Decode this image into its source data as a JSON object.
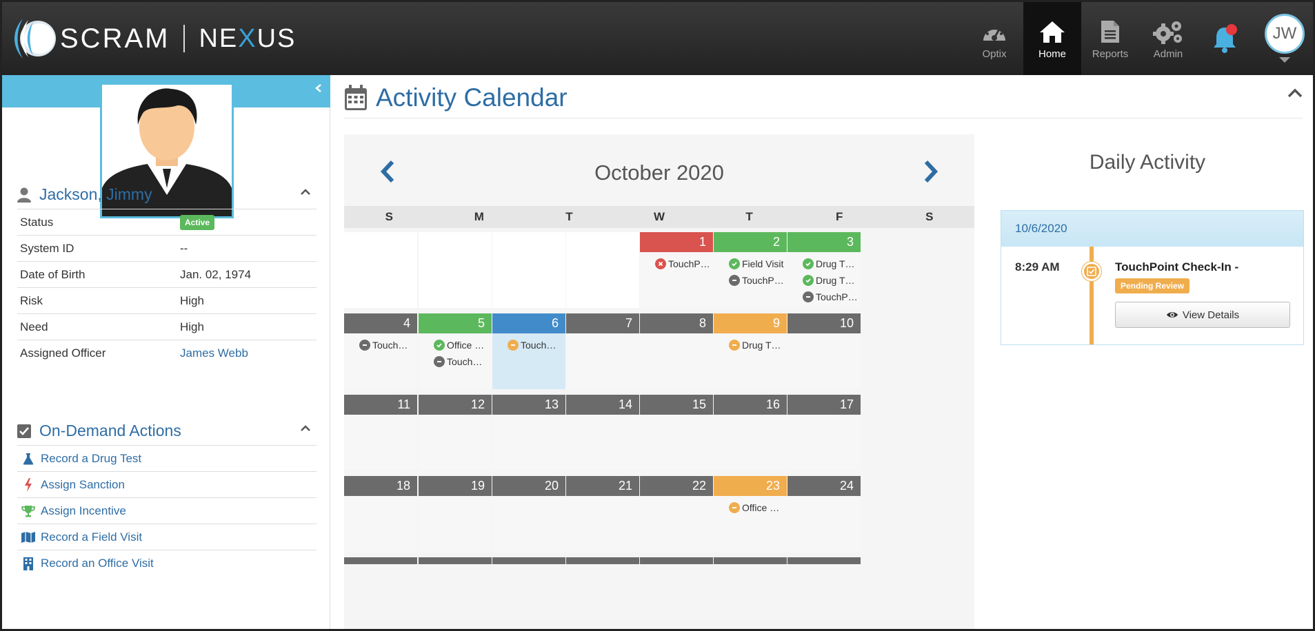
{
  "app": {
    "logo_text": "SCRAM",
    "logo_suffix_a": "NE",
    "logo_suffix_x": "X",
    "logo_suffix_b": "US"
  },
  "nav": {
    "items": [
      {
        "label": "Optix",
        "icon": "gauge-icon",
        "active": false
      },
      {
        "label": "Home",
        "icon": "home-icon",
        "active": true
      },
      {
        "label": "Reports",
        "icon": "document-icon",
        "active": false
      },
      {
        "label": "Admin",
        "icon": "gears-icon",
        "active": false
      }
    ],
    "user_initials": "JW",
    "notification_color": "#e8373d"
  },
  "profile": {
    "name": "Jackson, Jimmy",
    "rows": [
      {
        "label": "Status",
        "value": "Active",
        "type": "badge"
      },
      {
        "label": "System ID",
        "value": "--"
      },
      {
        "label": "Date of Birth",
        "value": "Jan. 02, 1974"
      },
      {
        "label": "Risk",
        "value": "High"
      },
      {
        "label": "Need",
        "value": "High"
      },
      {
        "label": "Assigned Officer",
        "value": "James Webb",
        "type": "link"
      }
    ]
  },
  "actions": {
    "title": "On-Demand Actions",
    "items": [
      {
        "label": "Record a Drug Test",
        "icon": "flask-icon",
        "color": "#2e6da4"
      },
      {
        "label": "Assign Sanction",
        "icon": "bolt-icon",
        "color": "#d9534f"
      },
      {
        "label": "Assign Incentive",
        "icon": "trophy-icon",
        "color": "#5cb85c"
      },
      {
        "label": "Record a Field Visit",
        "icon": "map-icon",
        "color": "#2e6da4"
      },
      {
        "label": "Record an Office Visit",
        "icon": "building-icon",
        "color": "#2e6da4"
      }
    ]
  },
  "calendar": {
    "title": "Activity Calendar",
    "month_label": "October 2020",
    "days_of_week": [
      "S",
      "M",
      "T",
      "W",
      "T",
      "F",
      "S"
    ],
    "weeks": [
      [
        {
          "day": null
        },
        {
          "day": null
        },
        {
          "day": null
        },
        {
          "day": null
        },
        {
          "day": "1",
          "header": "red",
          "events": [
            {
              "label": "TouchP…",
              "status": "fail"
            }
          ]
        },
        {
          "day": "2",
          "header": "green",
          "events": [
            {
              "label": "Field Visit",
              "status": "ok"
            },
            {
              "label": "TouchP…",
              "status": "neutral"
            }
          ]
        },
        {
          "day": "3",
          "header": "green",
          "events": [
            {
              "label": "Drug T…",
              "status": "ok"
            },
            {
              "label": "Drug T…",
              "status": "ok"
            },
            {
              "label": "TouchP…",
              "status": "neutral"
            }
          ]
        }
      ],
      [
        {
          "day": "4",
          "header": "gray",
          "events": [
            {
              "label": "Touch…",
              "status": "neutral"
            }
          ]
        },
        {
          "day": "5",
          "header": "green",
          "events": [
            {
              "label": "Office …",
              "status": "ok"
            },
            {
              "label": "Touch…",
              "status": "neutral"
            }
          ]
        },
        {
          "day": "6",
          "header": "blue",
          "today": true,
          "events": [
            {
              "label": "Touch…",
              "status": "pending"
            }
          ]
        },
        {
          "day": "7",
          "header": "gray",
          "events": []
        },
        {
          "day": "8",
          "header": "gray",
          "events": []
        },
        {
          "day": "9",
          "header": "orange",
          "events": [
            {
              "label": "Drug T…",
              "status": "pending"
            }
          ]
        },
        {
          "day": "10",
          "header": "gray",
          "events": []
        }
      ],
      [
        {
          "day": "11",
          "header": "gray",
          "events": []
        },
        {
          "day": "12",
          "header": "gray",
          "events": []
        },
        {
          "day": "13",
          "header": "gray",
          "events": []
        },
        {
          "day": "14",
          "header": "gray",
          "events": []
        },
        {
          "day": "15",
          "header": "gray",
          "events": []
        },
        {
          "day": "16",
          "header": "gray",
          "events": []
        },
        {
          "day": "17",
          "header": "gray",
          "events": []
        }
      ],
      [
        {
          "day": "18",
          "header": "gray",
          "events": []
        },
        {
          "day": "19",
          "header": "gray",
          "events": []
        },
        {
          "day": "20",
          "header": "gray",
          "events": []
        },
        {
          "day": "21",
          "header": "gray",
          "events": []
        },
        {
          "day": "22",
          "header": "gray",
          "events": []
        },
        {
          "day": "23",
          "header": "orange",
          "events": [
            {
              "label": "Office …",
              "status": "pending"
            }
          ]
        },
        {
          "day": "24",
          "header": "gray",
          "events": []
        }
      ]
    ],
    "status_colors": {
      "ok": "#5cb85c",
      "fail": "#d9534f",
      "neutral": "#6b6b6b",
      "pending": "#f0ad4e"
    }
  },
  "daily": {
    "title": "Daily Activity",
    "date": "10/6/2020",
    "entries": [
      {
        "time": "8:29 AM",
        "title": "TouchPoint Check-In -",
        "badge": "Pending Review",
        "button": "View Details"
      }
    ]
  }
}
